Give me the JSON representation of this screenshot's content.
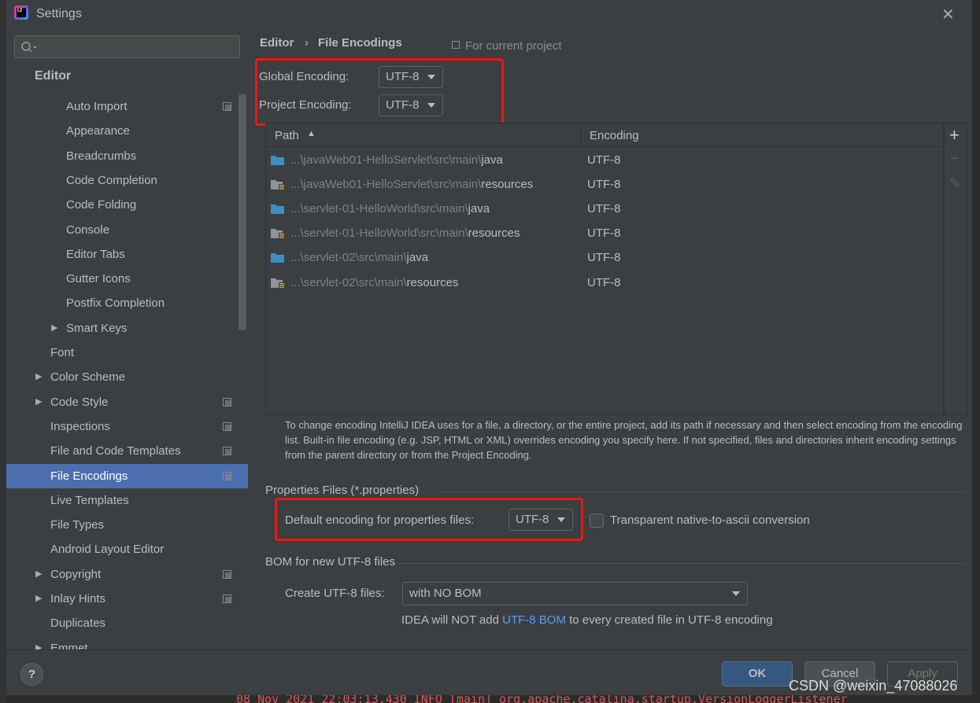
{
  "window": {
    "title": "Settings",
    "close_icon": "close-icon",
    "logo": "IJ"
  },
  "search": {
    "placeholder": ""
  },
  "sidebar": {
    "section": "Editor",
    "items": [
      {
        "label": "Auto Import",
        "level": 2,
        "copy": true
      },
      {
        "label": "Appearance",
        "level": 2
      },
      {
        "label": "Breadcrumbs",
        "level": 2
      },
      {
        "label": "Code Completion",
        "level": 2
      },
      {
        "label": "Code Folding",
        "level": 2
      },
      {
        "label": "Console",
        "level": 2
      },
      {
        "label": "Editor Tabs",
        "level": 2
      },
      {
        "label": "Gutter Icons",
        "level": 2
      },
      {
        "label": "Postfix Completion",
        "level": 2
      },
      {
        "label": "Smart Keys",
        "level": 2,
        "expandable": true
      },
      {
        "label": "Font",
        "level": 1
      },
      {
        "label": "Color Scheme",
        "level": 1,
        "expandable": true
      },
      {
        "label": "Code Style",
        "level": 1,
        "expandable": true,
        "copy": true
      },
      {
        "label": "Inspections",
        "level": 1,
        "copy": true
      },
      {
        "label": "File and Code Templates",
        "level": 1,
        "copy": true
      },
      {
        "label": "File Encodings",
        "level": 1,
        "copy": true,
        "selected": true
      },
      {
        "label": "Live Templates",
        "level": 1
      },
      {
        "label": "File Types",
        "level": 1
      },
      {
        "label": "Android Layout Editor",
        "level": 1
      },
      {
        "label": "Copyright",
        "level": 1,
        "expandable": true,
        "copy": true
      },
      {
        "label": "Inlay Hints",
        "level": 1,
        "expandable": true,
        "copy": true
      },
      {
        "label": "Duplicates",
        "level": 1
      },
      {
        "label": "Emmet",
        "level": 1,
        "expandable": true
      }
    ]
  },
  "breadcrumb": {
    "parent": "Editor",
    "separator": "›",
    "current": "File Encodings",
    "scope": "For current project"
  },
  "global_encoding": {
    "label": "Global Encoding:",
    "value": "UTF-8"
  },
  "project_encoding": {
    "label": "Project Encoding:",
    "value": "UTF-8"
  },
  "table": {
    "headers": {
      "path": "Path",
      "encoding": "Encoding",
      "sort": "▲"
    },
    "rows": [
      {
        "prefix": "...\\javaWeb01-HelloServlet\\src\\main\\",
        "leaf": "java",
        "encoding": "UTF-8",
        "type": "source"
      },
      {
        "prefix": "...\\javaWeb01-HelloServlet\\src\\main\\",
        "leaf": "resources",
        "encoding": "UTF-8",
        "type": "resources"
      },
      {
        "prefix": "...\\servlet-01-HelloWorld\\src\\main\\",
        "leaf": "java",
        "encoding": "UTF-8",
        "type": "source"
      },
      {
        "prefix": "...\\servlet-01-HelloWorld\\src\\main\\",
        "leaf": "resources",
        "encoding": "UTF-8",
        "type": "resources"
      },
      {
        "prefix": "...\\servlet-02\\src\\main\\",
        "leaf": "java",
        "encoding": "UTF-8",
        "type": "source"
      },
      {
        "prefix": "...\\servlet-02\\src\\main\\",
        "leaf": "resources",
        "encoding": "UTF-8",
        "type": "resources"
      }
    ],
    "tools": {
      "add": "+",
      "remove": "−",
      "edit": "✎"
    }
  },
  "note": "To change encoding IntelliJ IDEA uses for a file, a directory, or the entire project, add its path if necessary and then select encoding from the encoding list. Built-in file encoding (e.g. JSP, HTML or XML) overrides encoding you specify here. If not specified, files and directories inherit encoding settings from the parent directory or from the Project Encoding.",
  "properties": {
    "section": "Properties Files (*.properties)",
    "label": "Default encoding for properties files:",
    "value": "UTF-8",
    "transparent_label": "Transparent native-to-ascii conversion",
    "transparent_checked": false
  },
  "bom": {
    "section": "BOM for new UTF-8 files",
    "label": "Create UTF-8 files:",
    "value": "with NO BOM",
    "hint_pre": "IDEA will NOT add ",
    "hint_link": "UTF-8 BOM",
    "hint_post": " to every created file in UTF-8 encoding"
  },
  "buttons": {
    "help": "?",
    "ok": "OK",
    "cancel": "Cancel",
    "apply": "Apply"
  },
  "background_log": "08 Nov 2021 22:03:13.430 INFO [main] org.apache.catalina.startup.VersionLoggerListener",
  "watermark": "CSDN @weixin_47088026",
  "colors": {
    "selection": "#4b6eaf",
    "highlight_box": "#f5140f",
    "link": "#589df6",
    "source_folder": "#3d8fc2"
  }
}
